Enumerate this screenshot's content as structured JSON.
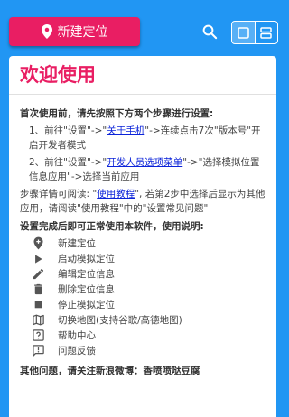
{
  "topbar": {
    "new_button_label": "新建定位",
    "icons": [
      "location-pin-icon",
      "search-icon",
      "list-layout-icon",
      "grid-layout-icon"
    ]
  },
  "dialog": {
    "title": "欢迎使用",
    "intro": "首次使用前，请先按照下方两个步骤进行设置:",
    "step1": {
      "prefix": "1、前往\"设置\"->\"",
      "link": "关于手机",
      "suffix": "\"->连续点击7次\"版本号\"开启开发者模式"
    },
    "step2": {
      "prefix": "2、前往\"设置\"->\"",
      "link": "开发人员选项菜单",
      "suffix": "\"->\"选择模拟位置信息应用\"->选择当前应用"
    },
    "details": {
      "prefix": "步骤详情可阅读: \"",
      "link": "使用教程",
      "suffix": "\", 若第2步中选择后显示为其他应用，请阅读\"使用教程\"中的\"设置常见问题\""
    },
    "legend_intro": "设置完成后即可正常使用本软件，使用说明:",
    "legend": [
      {
        "icon": "add-location-icon",
        "label": "新建定位"
      },
      {
        "icon": "play-icon",
        "label": "启动模拟定位"
      },
      {
        "icon": "edit-pencil-icon",
        "label": "编辑定位信息"
      },
      {
        "icon": "trash-icon",
        "label": "删除定位信息"
      },
      {
        "icon": "stop-icon",
        "label": "停止模拟定位"
      },
      {
        "icon": "map-icon",
        "label": "切换地图(支持谷歌/高德地图)"
      },
      {
        "icon": "help-icon",
        "label": "帮助中心"
      },
      {
        "icon": "feedback-icon",
        "label": "问题反馈"
      }
    ],
    "footer": "其他问题，请关注新浪微博：香喷喷哒豆腐"
  },
  "colors": {
    "background": "#2196f3",
    "accent": "#e91e63",
    "link": "#0b23d9"
  }
}
